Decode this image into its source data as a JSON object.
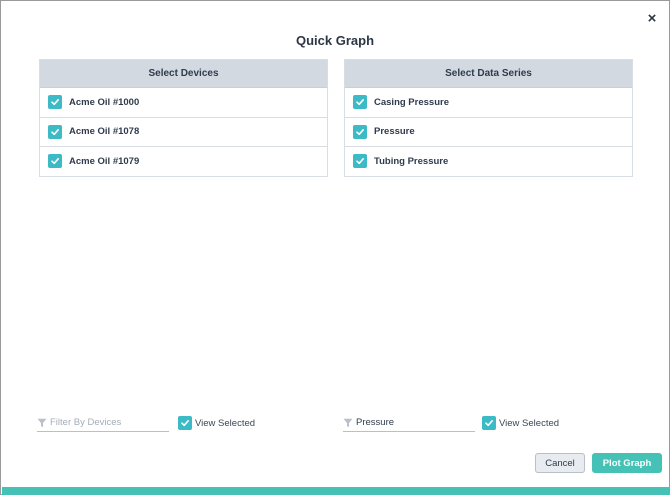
{
  "dialog": {
    "title": "Quick Graph",
    "close_symbol": "×"
  },
  "devices": {
    "header": "Select Devices",
    "items": [
      {
        "label": "Acme Oil #1000",
        "checked": true
      },
      {
        "label": "Acme Oil #1078",
        "checked": true
      },
      {
        "label": "Acme Oil #1079",
        "checked": true
      }
    ],
    "filter": {
      "value": "",
      "placeholder": "Filter By Devices"
    },
    "view_selected": {
      "label": "View Selected",
      "checked": true
    }
  },
  "series": {
    "header": "Select Data Series",
    "items": [
      {
        "label": "Casing Pressure",
        "checked": true
      },
      {
        "label": "Pressure",
        "checked": true
      },
      {
        "label": "Tubing Pressure",
        "checked": true
      }
    ],
    "filter": {
      "value": "Pressure",
      "placeholder": ""
    },
    "view_selected": {
      "label": "View Selected",
      "checked": true
    }
  },
  "buttons": {
    "cancel": "Cancel",
    "plot": "Plot Graph"
  },
  "icons": {
    "close": "close-icon",
    "checkbox": "checkmark-icon",
    "filter": "funnel-icon"
  },
  "colors": {
    "accent": "#45c1b5",
    "checkbox": "#3cbac6",
    "header_bg": "#d3d9e1"
  }
}
